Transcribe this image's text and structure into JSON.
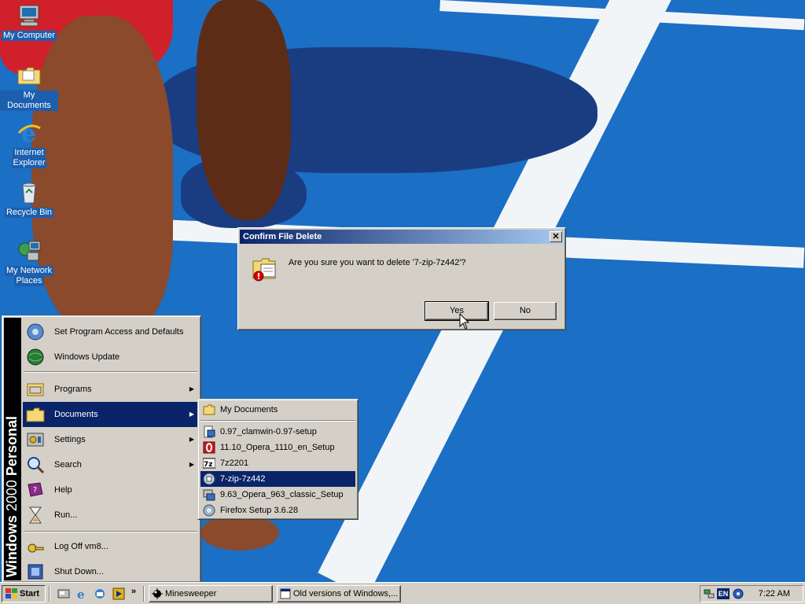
{
  "desktop": {
    "icons": [
      {
        "name": "my-computer",
        "label": "My Computer",
        "icon": "computer-icon"
      },
      {
        "name": "my-documents",
        "label": "My Documents",
        "icon": "folder-documents-icon"
      },
      {
        "name": "internet-explorer",
        "label": "Internet Explorer",
        "label_line1": "Internet",
        "label_line2": "Explorer",
        "icon": "internet-explorer-icon"
      },
      {
        "name": "recycle-bin",
        "label": "Recycle Bin",
        "icon": "recycle-bin-icon"
      },
      {
        "name": "my-network-places",
        "label": "My Network Places",
        "label_line1": "My Network",
        "label_line2": "Places",
        "icon": "network-icon"
      }
    ]
  },
  "dialog": {
    "title": "Confirm File Delete",
    "close_label": "✕",
    "message": "Are you sure you want to delete '7-zip-7z442'?",
    "icon": "delete-file-warning-icon",
    "yes_label": "Yes",
    "no_label": "No",
    "default_button": "yes"
  },
  "start_menu": {
    "banner_brand": "Windows",
    "banner_version": "2000",
    "banner_edition": "Personal",
    "items": [
      {
        "name": "set-program-access",
        "label": "Set Program Access and Defaults",
        "icon": "program-defaults-icon",
        "has_submenu": false
      },
      {
        "name": "windows-update",
        "label": "Windows Update",
        "icon": "windows-update-globe-icon",
        "has_submenu": false
      },
      {
        "name": "programs",
        "label": "Programs",
        "icon": "programs-icon",
        "has_submenu": true
      },
      {
        "name": "documents",
        "label": "Documents",
        "icon": "documents-folder-icon",
        "has_submenu": true,
        "active": true
      },
      {
        "name": "settings",
        "label": "Settings",
        "icon": "settings-icon",
        "has_submenu": true
      },
      {
        "name": "search",
        "label": "Search",
        "icon": "search-icon",
        "has_submenu": true
      },
      {
        "name": "help",
        "label": "Help",
        "icon": "help-book-icon",
        "has_submenu": false
      },
      {
        "name": "run",
        "label": "Run...",
        "icon": "run-icon",
        "has_submenu": false
      },
      {
        "name": "log-off",
        "label": "Log Off vm8...",
        "icon": "log-off-key-icon",
        "has_submenu": false
      },
      {
        "name": "shut-down",
        "label": "Shut Down...",
        "icon": "shut-down-icon",
        "has_submenu": false
      }
    ]
  },
  "documents_menu": {
    "items": [
      {
        "name": "my-documents",
        "label": "My Documents",
        "icon": "folder-icon"
      },
      {
        "name": "clamwin",
        "label": "0.97_clamwin-0.97-setup",
        "icon": "setup-file-icon"
      },
      {
        "name": "opera-1110",
        "label": "11.10_Opera_1110_en_Setup",
        "icon": "opera-icon"
      },
      {
        "name": "7z2201",
        "label": "7z2201",
        "icon": "7zip-icon"
      },
      {
        "name": "7zip-7z442",
        "label": "7-zip-7z442",
        "icon": "installer-icon",
        "active": true
      },
      {
        "name": "opera-963",
        "label": "9.63_Opera_963_classic_Setup",
        "icon": "installer-icon"
      },
      {
        "name": "firefox-setup",
        "label": "Firefox Setup 3.6.28",
        "icon": "installer-icon"
      }
    ]
  },
  "taskbar": {
    "start_label": "Start",
    "quick_launch_more": "»",
    "tasks": [
      {
        "name": "minesweeper",
        "label": "Minesweeper",
        "icon": "minesweeper-icon"
      },
      {
        "name": "old-versions",
        "label": "Old versions of Windows,...",
        "icon": "browser-window-icon"
      }
    ],
    "tray": {
      "language": "EN",
      "clock": "7:22 AM"
    }
  },
  "colors": {
    "window_face": "#d4d0c8",
    "selection": "#0a246a",
    "titlebar_start": "#0a246a",
    "titlebar_end": "#a6caf0",
    "desktop_blue": "#1b6fc4"
  }
}
